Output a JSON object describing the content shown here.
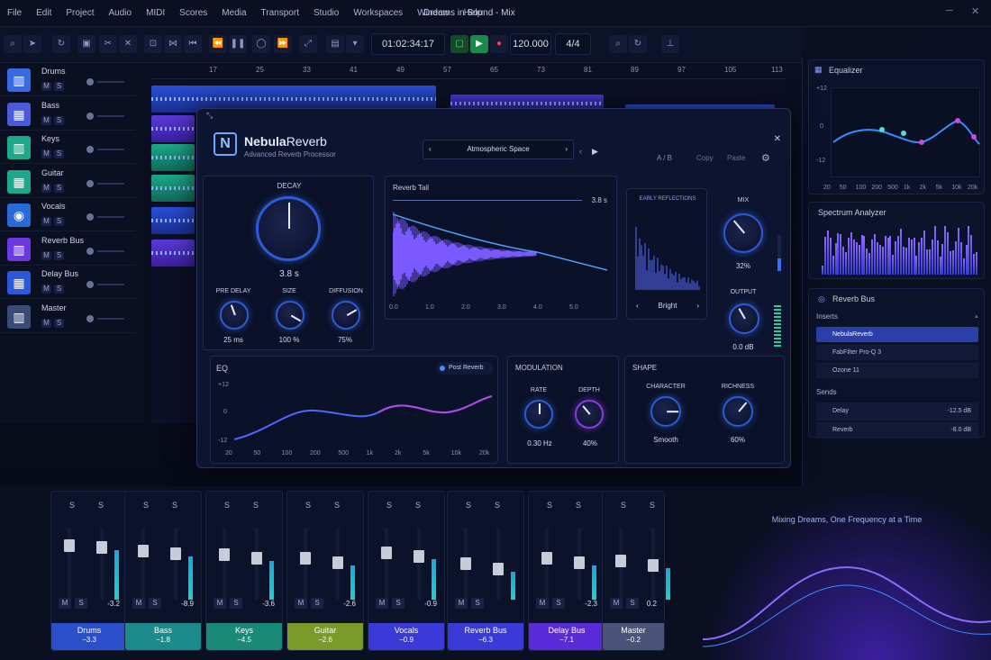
{
  "window": {
    "title": "Dreams in Sound - Mix"
  },
  "menu": [
    "File",
    "Edit",
    "Project",
    "Audio",
    "MIDI",
    "Scores",
    "Media",
    "Transport",
    "Studio",
    "Workspaces",
    "Window",
    "Help"
  ],
  "transport": {
    "time": "01:02:34:17",
    "tempo": "120.000",
    "signature": "4/4"
  },
  "ruler": [
    "17",
    "25",
    "33",
    "41",
    "49",
    "57",
    "65",
    "73",
    "81",
    "89",
    "97",
    "105",
    "113"
  ],
  "tracks": [
    {
      "name": "Drums",
      "color": "#3a6ae0"
    },
    {
      "name": "Bass",
      "color": "#4a5ad8"
    },
    {
      "name": "Keys",
      "color": "#1ea88a"
    },
    {
      "name": "Guitar",
      "color": "#1ea88a"
    },
    {
      "name": "Vocals",
      "color": "#2a6ad8"
    },
    {
      "name": "Reverb Bus",
      "color": "#6a3ae0"
    },
    {
      "name": "Delay Bus",
      "color": "#2a5ad8"
    },
    {
      "name": "Master",
      "color": "#3a4a78"
    }
  ],
  "plugin": {
    "brand_bold": "Nebula",
    "brand_light": "Reverb",
    "subtitle": "Advanced Reverb Processor",
    "preset": "Atmospheric Space",
    "ab": "A / B",
    "copy": "Copy",
    "paste": "Paste",
    "decay": {
      "label": "DECAY",
      "value": "3.8 s"
    },
    "predelay": {
      "label": "PRE DELAY",
      "value": "25 ms"
    },
    "size": {
      "label": "SIZE",
      "value": "100 %"
    },
    "diffusion": {
      "label": "DIFFUSION",
      "value": "75%"
    },
    "tail": {
      "label": "Reverb Tail",
      "length": "3.8 s",
      "axis": [
        "0.0",
        "1.0",
        "2.0",
        "3.0",
        "4.0",
        "5.0"
      ]
    },
    "early": {
      "label": "EARLY REFLECTIONS",
      "mode": "Bright"
    },
    "mix": {
      "label": "MIX",
      "value": "32%"
    },
    "output": {
      "label": "OUTPUT",
      "value": "0.0 dB"
    },
    "eq": {
      "label": "EQ",
      "toggle": "Post Reverb",
      "ylabels": [
        "+12",
        "0",
        "-12"
      ],
      "xlabels": [
        "20",
        "50",
        "100",
        "200",
        "500",
        "1k",
        "2k",
        "5k",
        "10k",
        "20k"
      ]
    },
    "modulation": {
      "label": "MODULATION",
      "rate_label": "RATE",
      "rate": "0.30 Hz",
      "depth_label": "DEPTH",
      "depth": "40%"
    },
    "shape": {
      "label": "SHAPE",
      "character_label": "CHARACTER",
      "character": "Smooth",
      "richness_label": "RICHNESS",
      "richness": "60%"
    }
  },
  "equalizer": {
    "title": "Equalizer",
    "ylabels": [
      "+12",
      "0",
      "-12"
    ],
    "xlabels": [
      "20",
      "50",
      "100",
      "200",
      "500",
      "1k",
      "2k",
      "5k",
      "10k",
      "20k"
    ]
  },
  "spectrum": {
    "title": "Spectrum Analyzer"
  },
  "bus": {
    "title": "Reverb Bus",
    "inserts_label": "Inserts",
    "inserts": [
      "NebulaReverb",
      "FabFilter Pro-Q 3",
      "Ozone 11"
    ],
    "sends_label": "Sends",
    "sends": [
      {
        "name": "Delay",
        "value": "-12.5 dB"
      },
      {
        "name": "Reverb",
        "value": "-8.0 dB"
      }
    ]
  },
  "mixer": [
    {
      "name": "Drums",
      "db": "-3.2",
      "readout": "−3.3",
      "color": "#2a4fc8",
      "level": 0.78
    },
    {
      "name": "Bass",
      "db": "-8.9",
      "readout": "−1.8",
      "color": "#1a8a8a",
      "level": 0.68
    },
    {
      "name": "Keys",
      "db": "-3.6",
      "readout": "−4.5",
      "color": "#1a8a78",
      "level": 0.62
    },
    {
      "name": "Guitar",
      "db": "-2.6",
      "readout": "−2.6",
      "color": "#7a9a2a",
      "level": 0.55
    },
    {
      "name": "Vocals",
      "db": "-0.9",
      "readout": "−0.9",
      "color": "#3a3ad8",
      "level": 0.65
    },
    {
      "name": "Reverb Bus",
      "db": "",
      "readout": "−6.3",
      "color": "#3a3ad8",
      "level": 0.45
    },
    {
      "name": "Delay Bus",
      "db": "-2.3",
      "readout": "−7.1",
      "color": "#5a2ad8",
      "level": 0.55
    },
    {
      "name": "Master",
      "db": "0.2",
      "readout": "−0.2",
      "color": "#4a5478",
      "level": 0.5
    }
  ],
  "promo": "Mixing Dreams, One Frequency at a Time"
}
